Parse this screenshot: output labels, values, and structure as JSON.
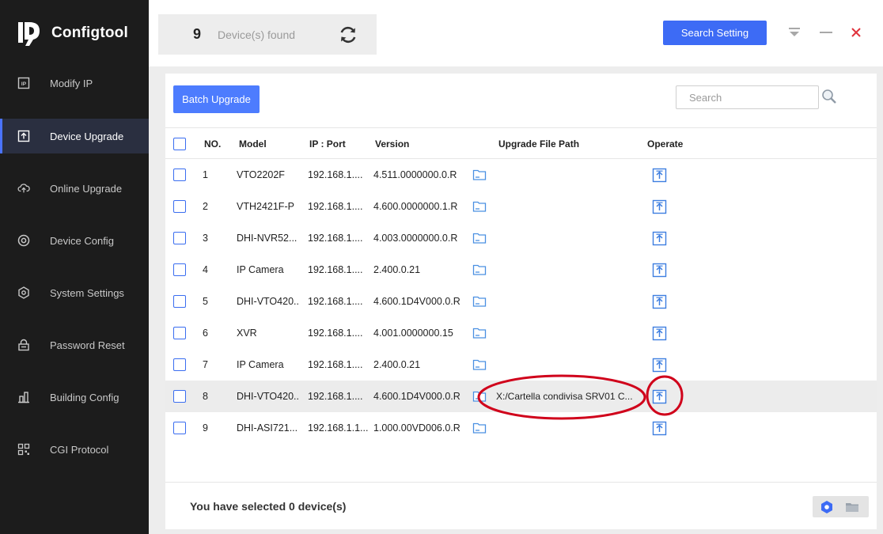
{
  "app": {
    "name": "Configtool"
  },
  "colors": {
    "accent": "#3d6bf5",
    "sidebar": "#1c1c1c",
    "annotation": "#d0021b"
  },
  "sidebar": {
    "items": [
      {
        "label": "Modify IP",
        "icon": "ip-icon"
      },
      {
        "label": "Device Upgrade",
        "icon": "upgrade-icon",
        "active": true
      },
      {
        "label": "Online Upgrade",
        "icon": "cloud-upload-icon"
      },
      {
        "label": "Device Config",
        "icon": "target-icon"
      },
      {
        "label": "System Settings",
        "icon": "hexagon-gear-icon"
      },
      {
        "label": "Password Reset",
        "icon": "lock-icon"
      },
      {
        "label": "Building Config",
        "icon": "building-icon"
      },
      {
        "label": "CGI Protocol",
        "icon": "qr-icon"
      }
    ]
  },
  "header": {
    "count": "9",
    "found_label": "Device(s) found",
    "search_setting_label": "Search Setting"
  },
  "toolbar": {
    "batch_upgrade_label": "Batch Upgrade",
    "search_placeholder": "Search"
  },
  "table": {
    "columns": [
      "NO.",
      "Model",
      "IP : Port",
      "Version",
      "Upgrade File Path",
      "Operate"
    ],
    "rows": [
      {
        "no": "1",
        "model": "VTO2202F",
        "ip": "192.168.1....",
        "version": "4.511.0000000.0.R",
        "path": ""
      },
      {
        "no": "2",
        "model": "VTH2421F-P",
        "ip": "192.168.1....",
        "version": "4.600.0000000.1.R",
        "path": ""
      },
      {
        "no": "3",
        "model": "DHI-NVR52...",
        "ip": "192.168.1....",
        "version": "4.003.0000000.0.R",
        "path": ""
      },
      {
        "no": "4",
        "model": "IP Camera",
        "ip": "192.168.1....",
        "version": "2.400.0.21",
        "path": ""
      },
      {
        "no": "5",
        "model": "DHI-VTO420...",
        "ip": "192.168.1....",
        "version": "4.600.1D4V000.0.R",
        "path": ""
      },
      {
        "no": "6",
        "model": "XVR",
        "ip": "192.168.1....",
        "version": "4.001.0000000.15",
        "path": ""
      },
      {
        "no": "7",
        "model": "IP Camera",
        "ip": "192.168.1....",
        "version": "2.400.0.21",
        "path": ""
      },
      {
        "no": "8",
        "model": "DHI-VTO420...",
        "ip": "192.168.1....",
        "version": "4.600.1D4V000.0.R",
        "path": "X:/Cartella condivisa SRV01 C...",
        "highlighted": true
      },
      {
        "no": "9",
        "model": "DHI-ASI721...",
        "ip": "192.168.1.1...",
        "version": "1.000.00VD006.0.R",
        "path": ""
      }
    ]
  },
  "footer": {
    "selected_prefix": "You have selected",
    "selected_count": "0",
    "selected_suffix": "device(s)"
  }
}
